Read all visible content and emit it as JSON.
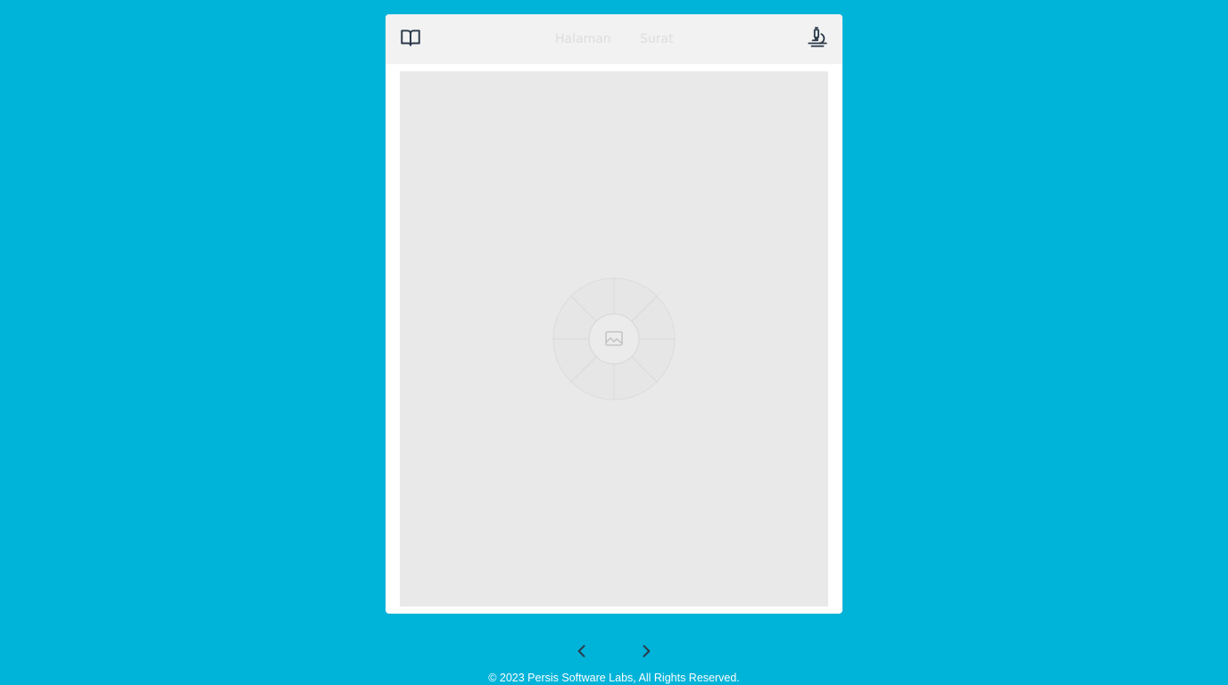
{
  "header": {
    "tabs": [
      {
        "label": "Halaman"
      },
      {
        "label": "Surat"
      }
    ],
    "left_icon": "book-open-icon",
    "right_icon": "microscope-icon"
  },
  "content": {
    "placeholder_icon": "image-placeholder-icon"
  },
  "navigation": {
    "prev_icon": "chevron-left-icon",
    "next_icon": "chevron-right-icon"
  },
  "footer": {
    "copyright": "© 2023 Persis Software Labs, All Rights Reserved."
  },
  "colors": {
    "background": "#00b3d9",
    "header": "#f2f2f2",
    "page_placeholder": "#e9e9e9",
    "icon": "#2b3a4a"
  }
}
